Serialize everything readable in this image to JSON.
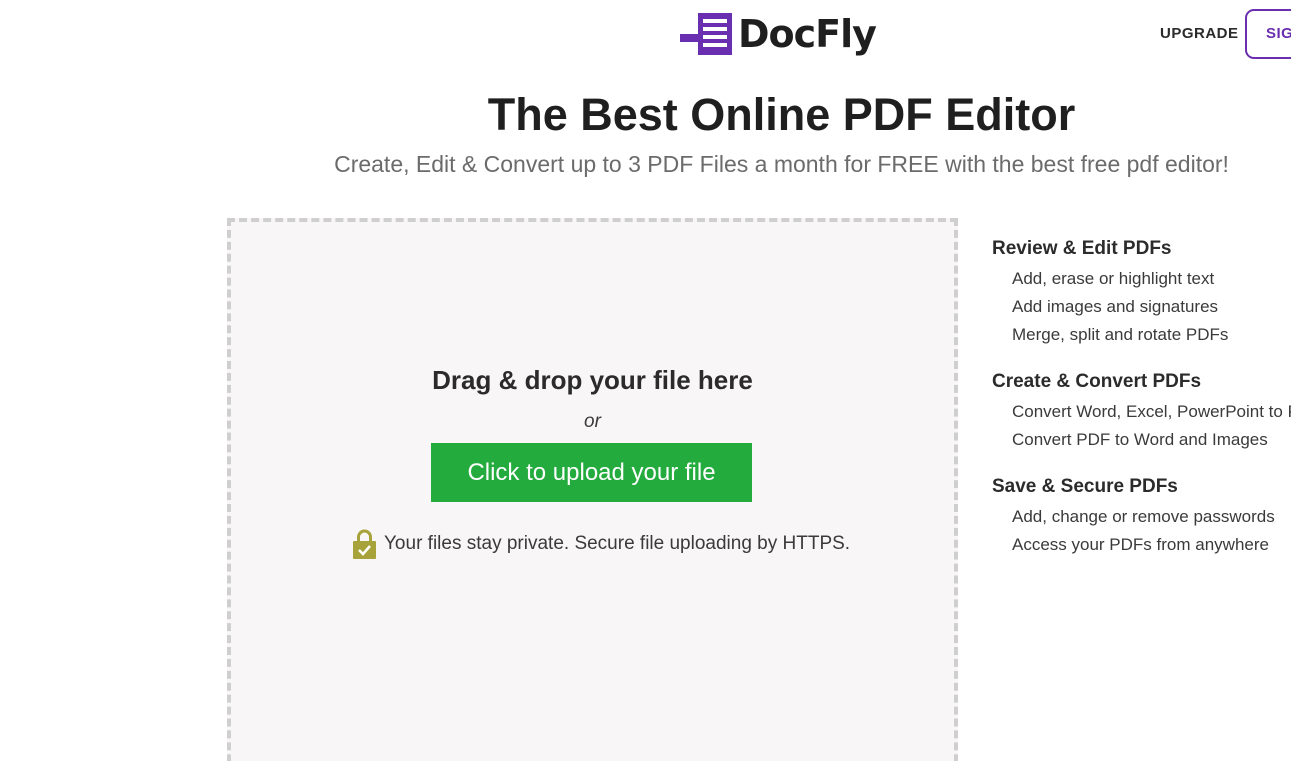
{
  "header": {
    "logo_text": "DocFly",
    "logo_icon": "docfly-logo-icon",
    "upgrade_label": "UPGRADE",
    "signin_label": "SIGN IN"
  },
  "hero": {
    "title": "The Best Online PDF Editor",
    "subtitle": "Create, Edit & Convert up to 3 PDF Files a month for FREE with the best free pdf editor!"
  },
  "dropzone": {
    "title": "Drag & drop your file here",
    "or_text": "or",
    "upload_label": "Click to upload your file",
    "privacy_text": "Your files stay private. Secure file uploading by HTTPS.",
    "lock_icon": "lock-check-icon"
  },
  "features": [
    {
      "heading": "Review & Edit PDFs",
      "items": [
        "Add, erase or highlight text",
        "Add images and signatures",
        "Merge, split and rotate PDFs"
      ]
    },
    {
      "heading": "Create & Convert PDFs",
      "items": [
        "Convert Word, Excel, PowerPoint to PDF",
        "Convert PDF to Word and Images"
      ]
    },
    {
      "heading": "Save & Secure PDFs",
      "items": [
        "Add, change or remove passwords",
        "Access your PDFs from anywhere"
      ]
    }
  ],
  "colors": {
    "brand_purple": "#6a2fb0",
    "upload_green": "#23ab3e",
    "lock_olive": "#a7a33a",
    "dropzone_bg": "#f9f6f7"
  }
}
